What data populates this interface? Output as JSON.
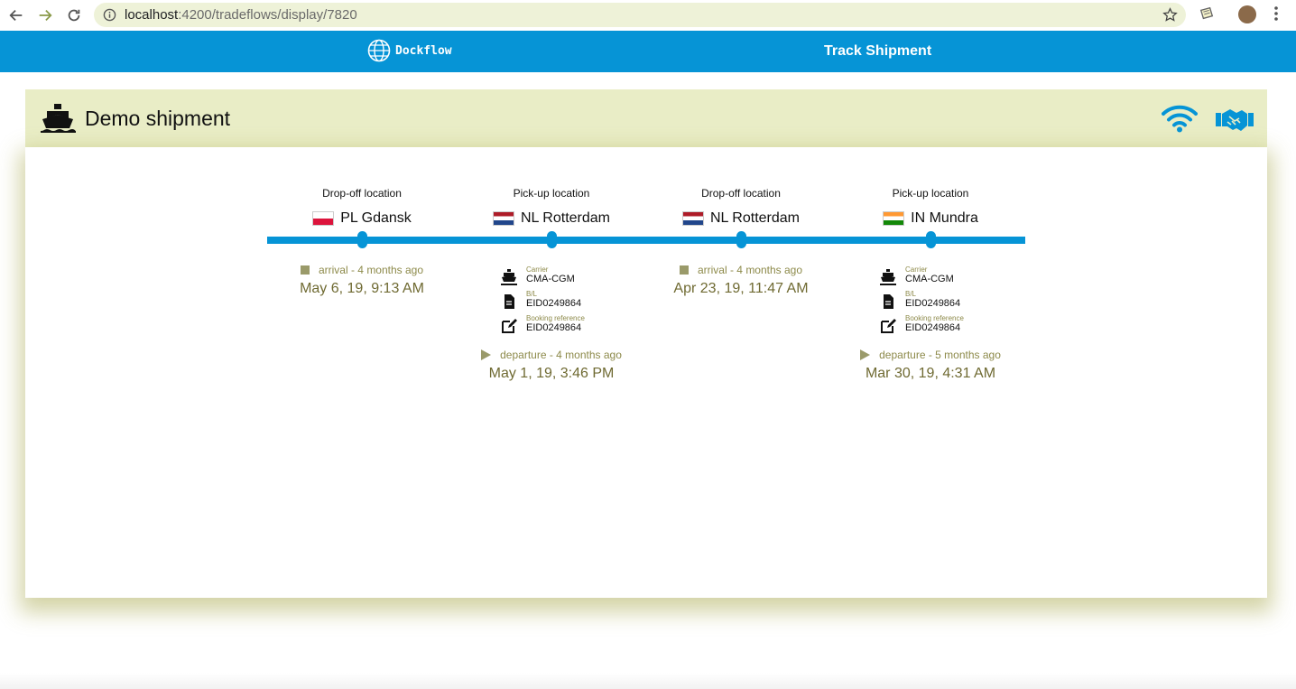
{
  "browser": {
    "url_host": "localhost",
    "url_path": ":4200/tradeflows/display/7820"
  },
  "appbar": {
    "brand": "Dockflow",
    "track_label": "Track Shipment"
  },
  "shipment": {
    "title": "Demo shipment"
  },
  "colors": {
    "primary": "#0694d6",
    "header_bg": "#e9edc6",
    "event_text": "#8d8a4a"
  },
  "stops": [
    {
      "type": "Drop-off location",
      "flag": "pl",
      "location": "PL Gdansk",
      "event": {
        "kind": "arrival",
        "label": "arrival - 4 months ago",
        "date": "May 6, 19, 9:13 AM"
      },
      "details": null
    },
    {
      "type": "Pick-up location",
      "flag": "nl",
      "location": "NL Rotterdam",
      "event": {
        "kind": "departure",
        "label": "departure - 4 months ago",
        "date": "May 1, 19, 3:46 PM"
      },
      "details": {
        "carrier_label": "Carrier",
        "carrier": "CMA-CGM",
        "bl_label": "B/L",
        "bl": "EID0249864",
        "booking_label": "Booking reference",
        "booking": "EID0249864"
      }
    },
    {
      "type": "Drop-off location",
      "flag": "nl",
      "location": "NL Rotterdam",
      "event": {
        "kind": "arrival",
        "label": "arrival - 4 months ago",
        "date": "Apr 23, 19, 11:47 AM"
      },
      "details": null
    },
    {
      "type": "Pick-up location",
      "flag": "in",
      "location": "IN Mundra",
      "event": {
        "kind": "departure",
        "label": "departure - 5 months ago",
        "date": "Mar 30, 19, 4:31 AM"
      },
      "details": {
        "carrier_label": "Carrier",
        "carrier": "CMA-CGM",
        "bl_label": "B/L",
        "bl": "EID0249864",
        "booking_label": "Booking reference",
        "booking": "EID0249864"
      }
    }
  ]
}
